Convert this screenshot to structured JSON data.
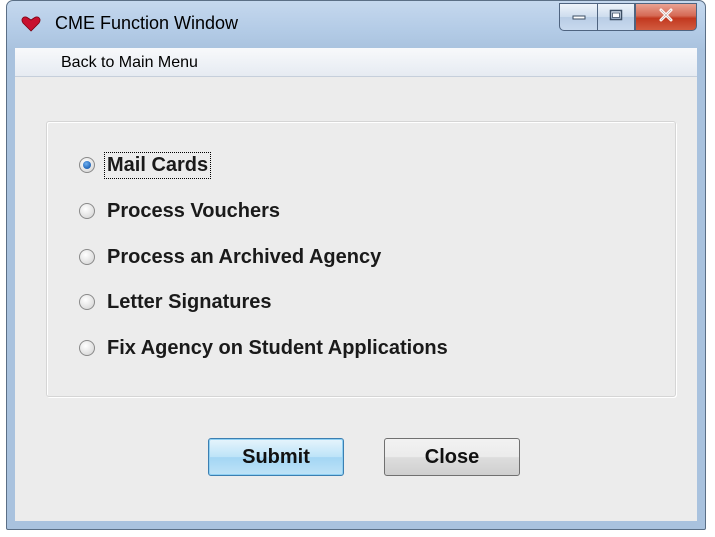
{
  "window": {
    "title": "CME Function Window",
    "controls": {
      "minimize": "minimize-icon",
      "maximize": "maximize-icon",
      "close": "close-icon"
    }
  },
  "menu": {
    "items": [
      {
        "label": "Back to Main Menu"
      }
    ]
  },
  "options": {
    "selected": "Mail Cards",
    "items": [
      {
        "label": "Mail Cards",
        "checked": true
      },
      {
        "label": "Process Vouchers",
        "checked": false
      },
      {
        "label": "Process an Archived Agency",
        "checked": false
      },
      {
        "label": "Letter Signatures",
        "checked": false
      },
      {
        "label": "Fix Agency on Student Applications",
        "checked": false
      }
    ]
  },
  "buttons": {
    "submit": "Submit",
    "close": "Close"
  },
  "colors": {
    "title_bar": "#b3cbe6",
    "client_bg": "#ececec",
    "close_button": "#c2381f",
    "default_button": "#bde4f8",
    "radio_selected": "#2a6fc0"
  }
}
